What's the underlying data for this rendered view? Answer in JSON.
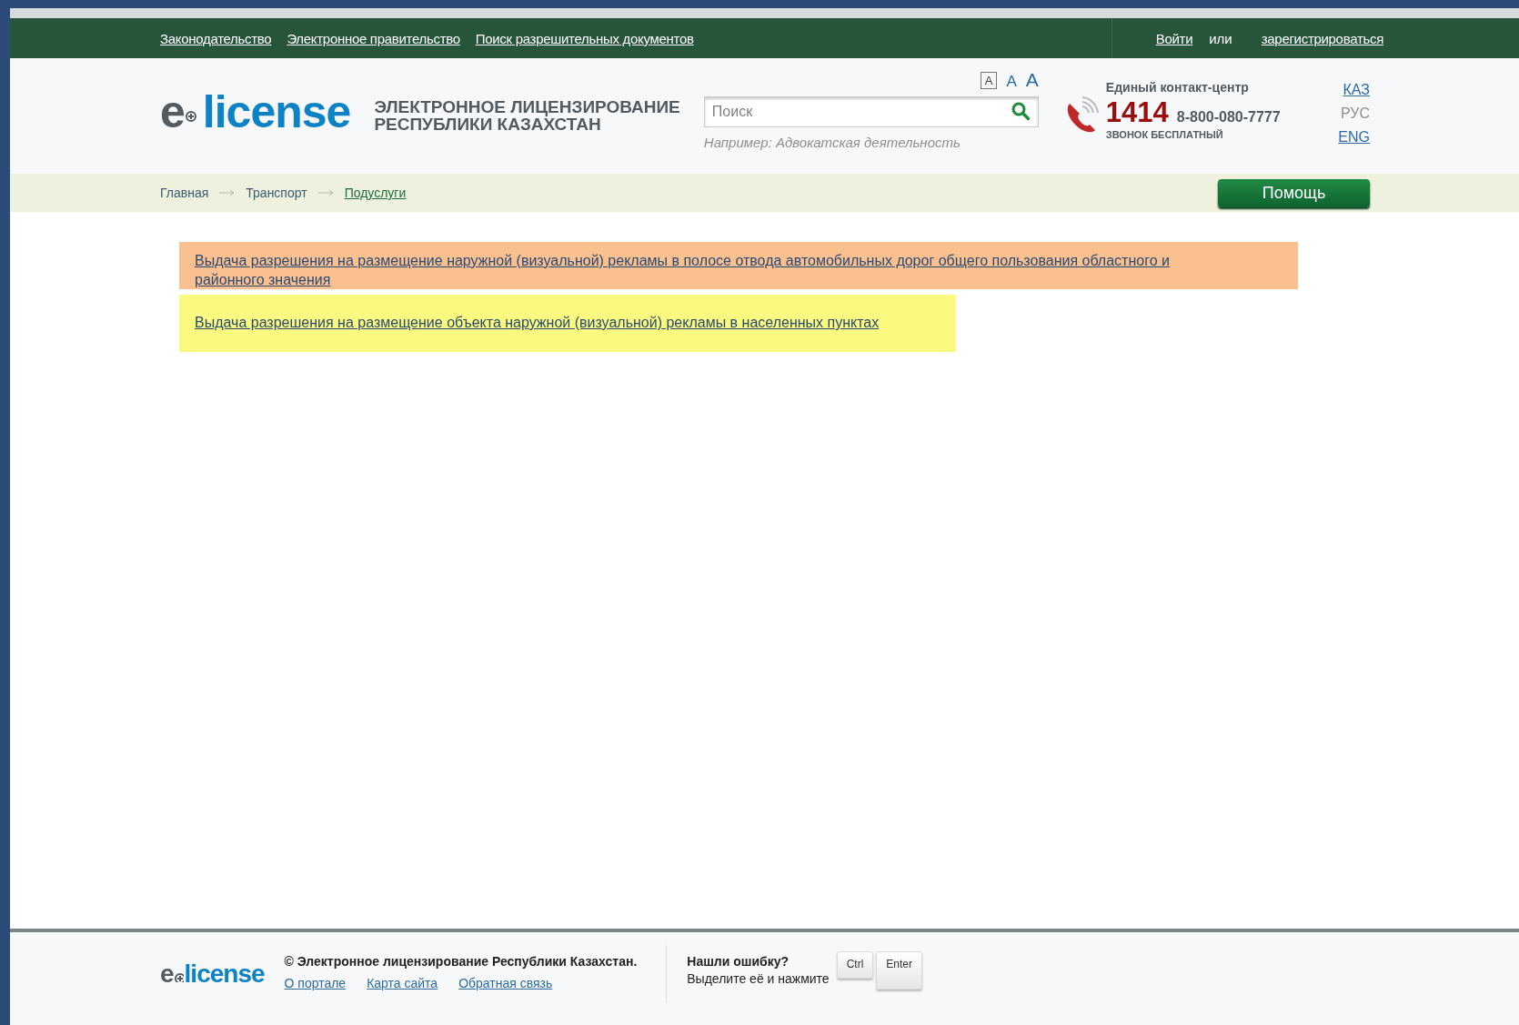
{
  "top_bar": {
    "links": [
      "Законодательство",
      "Электронное правительство",
      "Поиск разрешительных документов"
    ],
    "login": "Войти",
    "or": "или",
    "register": "зарегистрироваться"
  },
  "header": {
    "logo": {
      "prefix": "e",
      "name": "license"
    },
    "title_lines": [
      "ЭЛЕКТРОННОЕ ЛИЦЕНЗИРОВАНИЕ",
      "РЕСПУБЛИКИ КАЗАХСТАН"
    ],
    "font_sizes": [
      {
        "label": "A",
        "selected": true
      },
      {
        "label": "A",
        "selected": false
      },
      {
        "label": "A",
        "selected": false
      }
    ],
    "search": {
      "placeholder": "Поиск",
      "hint": "Например: Адвокатская деятельность"
    },
    "contact": {
      "title": "Единый контакт-центр",
      "short_number": "1414",
      "number": "8-800-080-7777",
      "note": "ЗВОНОК БЕСПЛАТНЫЙ"
    },
    "languages": [
      {
        "label": "КАЗ",
        "selected": false
      },
      {
        "label": "РУС",
        "selected": true
      },
      {
        "label": "ENG",
        "selected": false
      }
    ]
  },
  "breadcrumbs": [
    {
      "label": "Главная",
      "current": false
    },
    {
      "label": "Транспорт",
      "current": false
    },
    {
      "label": "Подуслуги",
      "current": true
    }
  ],
  "help_button": "Помощь",
  "subservices": [
    {
      "label": "Выдача разрешения на размещение наружной (визуальной) рекламы в полосе отвода автомобильных дорог общего пользования областного и районного значения",
      "color": "#fac090"
    },
    {
      "label": "Выдача разрешения на размещение объекта наружной (визуальной) рекламы в населенных пунктах",
      "color": "#fafa80"
    }
  ],
  "footer": {
    "logo": {
      "prefix": "e",
      "name": "license"
    },
    "copyright": "© Электронное лицензирование Республики Казахстан.",
    "links": [
      "О портале",
      "Карта сайта",
      "Обратная связь"
    ],
    "error_title": "Нашли ошибку?",
    "error_text": "Выделите её и нажмите",
    "keys": [
      "Ctrl",
      "Enter"
    ]
  }
}
